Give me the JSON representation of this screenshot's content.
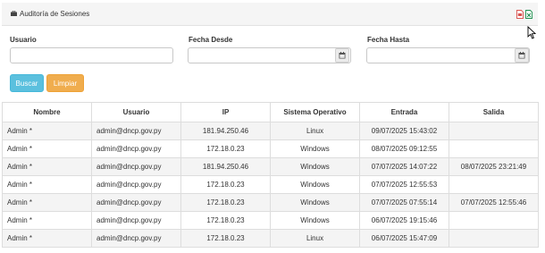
{
  "panel": {
    "title": "Auditoría de Sesiones"
  },
  "filters": {
    "usuario_label": "Usuario",
    "fecha_desde_label": "Fecha Desde",
    "fecha_hasta_label": "Fecha Hasta",
    "usuario_value": "",
    "fecha_desde_value": "",
    "fecha_hasta_value": ""
  },
  "buttons": {
    "buscar": "Buscar",
    "limpiar": "Limpiar"
  },
  "icons": {
    "header": "briefcase-icon",
    "export_pdf": "pdf-file-icon",
    "export_excel": "excel-file-icon",
    "calendar": "calendar-icon",
    "cursor": "mouse-pointer-icon"
  },
  "colors": {
    "buscar": "#5bc0de",
    "limpiar": "#f0ad4e",
    "pdf": "#d9534f",
    "excel": "#1d8f4e"
  },
  "table": {
    "headers": [
      "Nombre",
      "Usuario",
      "IP",
      "Sistema Operativo",
      "Entrada",
      "Salida"
    ],
    "rows": [
      [
        "Admin *",
        "admin@dncp.gov.py",
        "181.94.250.46",
        "Linux",
        "09/07/2025 15:43:02",
        ""
      ],
      [
        "Admin *",
        "admin@dncp.gov.py",
        "172.18.0.23",
        "Windows",
        "08/07/2025 09:12:55",
        ""
      ],
      [
        "Admin *",
        "admin@dncp.gov.py",
        "181.94.250.46",
        "Windows",
        "07/07/2025 14:07:22",
        "08/07/2025 23:21:49"
      ],
      [
        "Admin *",
        "admin@dncp.gov.py",
        "172.18.0.23",
        "Windows",
        "07/07/2025 12:55:53",
        ""
      ],
      [
        "Admin *",
        "admin@dncp.gov.py",
        "172.18.0.23",
        "Windows",
        "07/07/2025 07:55:14",
        "07/07/2025 12:55:46"
      ],
      [
        "Admin *",
        "admin@dncp.gov.py",
        "172.18.0.23",
        "Windows",
        "06/07/2025 19:15:46",
        ""
      ],
      [
        "Admin *",
        "admin@dncp.gov.py",
        "172.18.0.23",
        "Linux",
        "06/07/2025 15:47:09",
        ""
      ]
    ]
  }
}
